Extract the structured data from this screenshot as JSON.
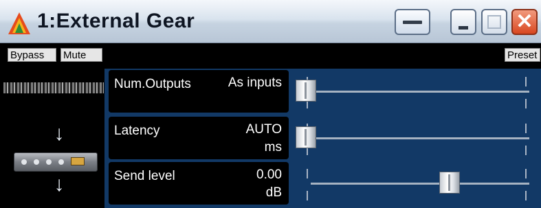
{
  "window": {
    "title": "1:External Gear",
    "buttons": {
      "rollup": "rollup-icon",
      "minimize": "minimize-icon",
      "maximize": "maximize-icon",
      "close": "close-icon",
      "close_glyph": "✕"
    }
  },
  "toolbar": {
    "bypass_label": "Bypass",
    "mute_label": "Mute",
    "preset_label": "Preset"
  },
  "diagram": {
    "arrow_glyph": "↓",
    "icons": [
      "signal-strip-icon",
      "arrow-down-icon",
      "rack-gear-icon"
    ]
  },
  "params": [
    {
      "label": "Num.Outputs",
      "value": "As inputs",
      "unit": "",
      "slider_position": 0.0
    },
    {
      "label": "Latency",
      "value": "AUTO",
      "unit": "ms",
      "slider_position": 0.0
    },
    {
      "label": "Send level",
      "value": "0.00",
      "unit": "dB",
      "slider_position": 0.66
    }
  ],
  "colors": {
    "panel_bg": "#123966",
    "label_bg": "#000000",
    "title_text": "#0e1522",
    "close_red": "#d84720"
  }
}
